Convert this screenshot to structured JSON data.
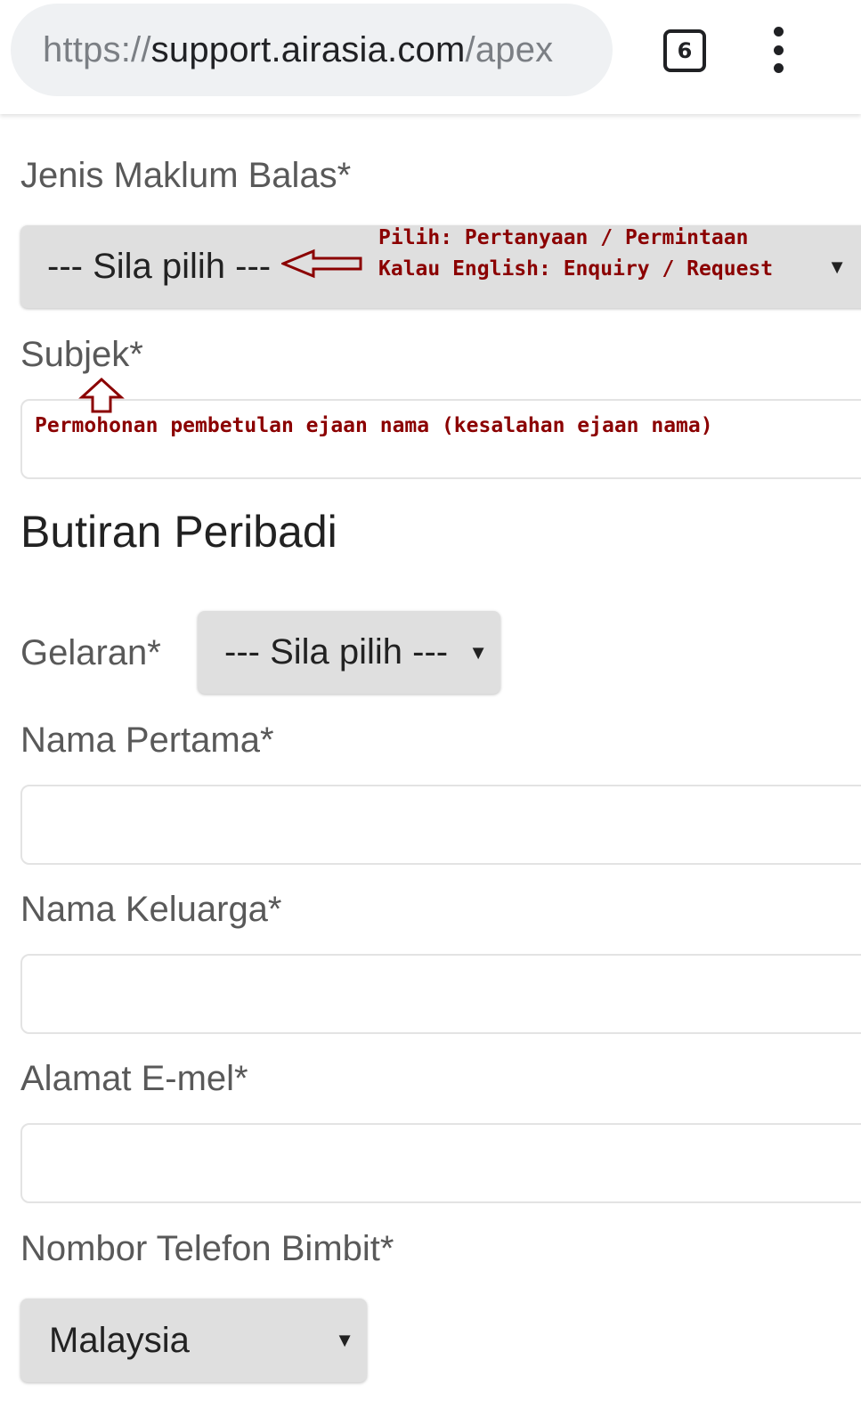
{
  "browser": {
    "url_scheme": "https://",
    "url_host": "support.airasia.com",
    "url_path": "/apex",
    "tab_count": "6"
  },
  "form": {
    "feedback_type": {
      "label": "Jenis Maklum Balas*",
      "selected": "--- Sila pilih ---"
    },
    "subject": {
      "label": "Subjek*",
      "value": ""
    },
    "section_title": "Butiran Peribadi",
    "title_field": {
      "label": "Gelaran*",
      "selected": "--- Sila pilih ---"
    },
    "first_name": {
      "label": "Nama Pertama*",
      "value": ""
    },
    "last_name": {
      "label": "Nama Keluarga*",
      "value": ""
    },
    "email": {
      "label": "Alamat E-mel*",
      "value": ""
    },
    "mobile": {
      "label": "Nombor Telefon Bimbit*",
      "country_selected": "Malaysia"
    }
  },
  "annotations": {
    "feedback_type_note_line1": "Pilih: Pertanyaan / Permintaan",
    "feedback_type_note_line2": "Kalau English: Enquiry / Request",
    "subject_note": "Permohonan pembetulan ejaan nama (kesalahan ejaan nama)",
    "color": "#8b0000"
  },
  "icons": {
    "dropdown": "caret-down-icon",
    "menu": "vertical-dots-icon",
    "tabs": "tab-switcher-icon",
    "annotation_left": "outline-left-arrow",
    "annotation_up": "outline-up-arrow"
  }
}
